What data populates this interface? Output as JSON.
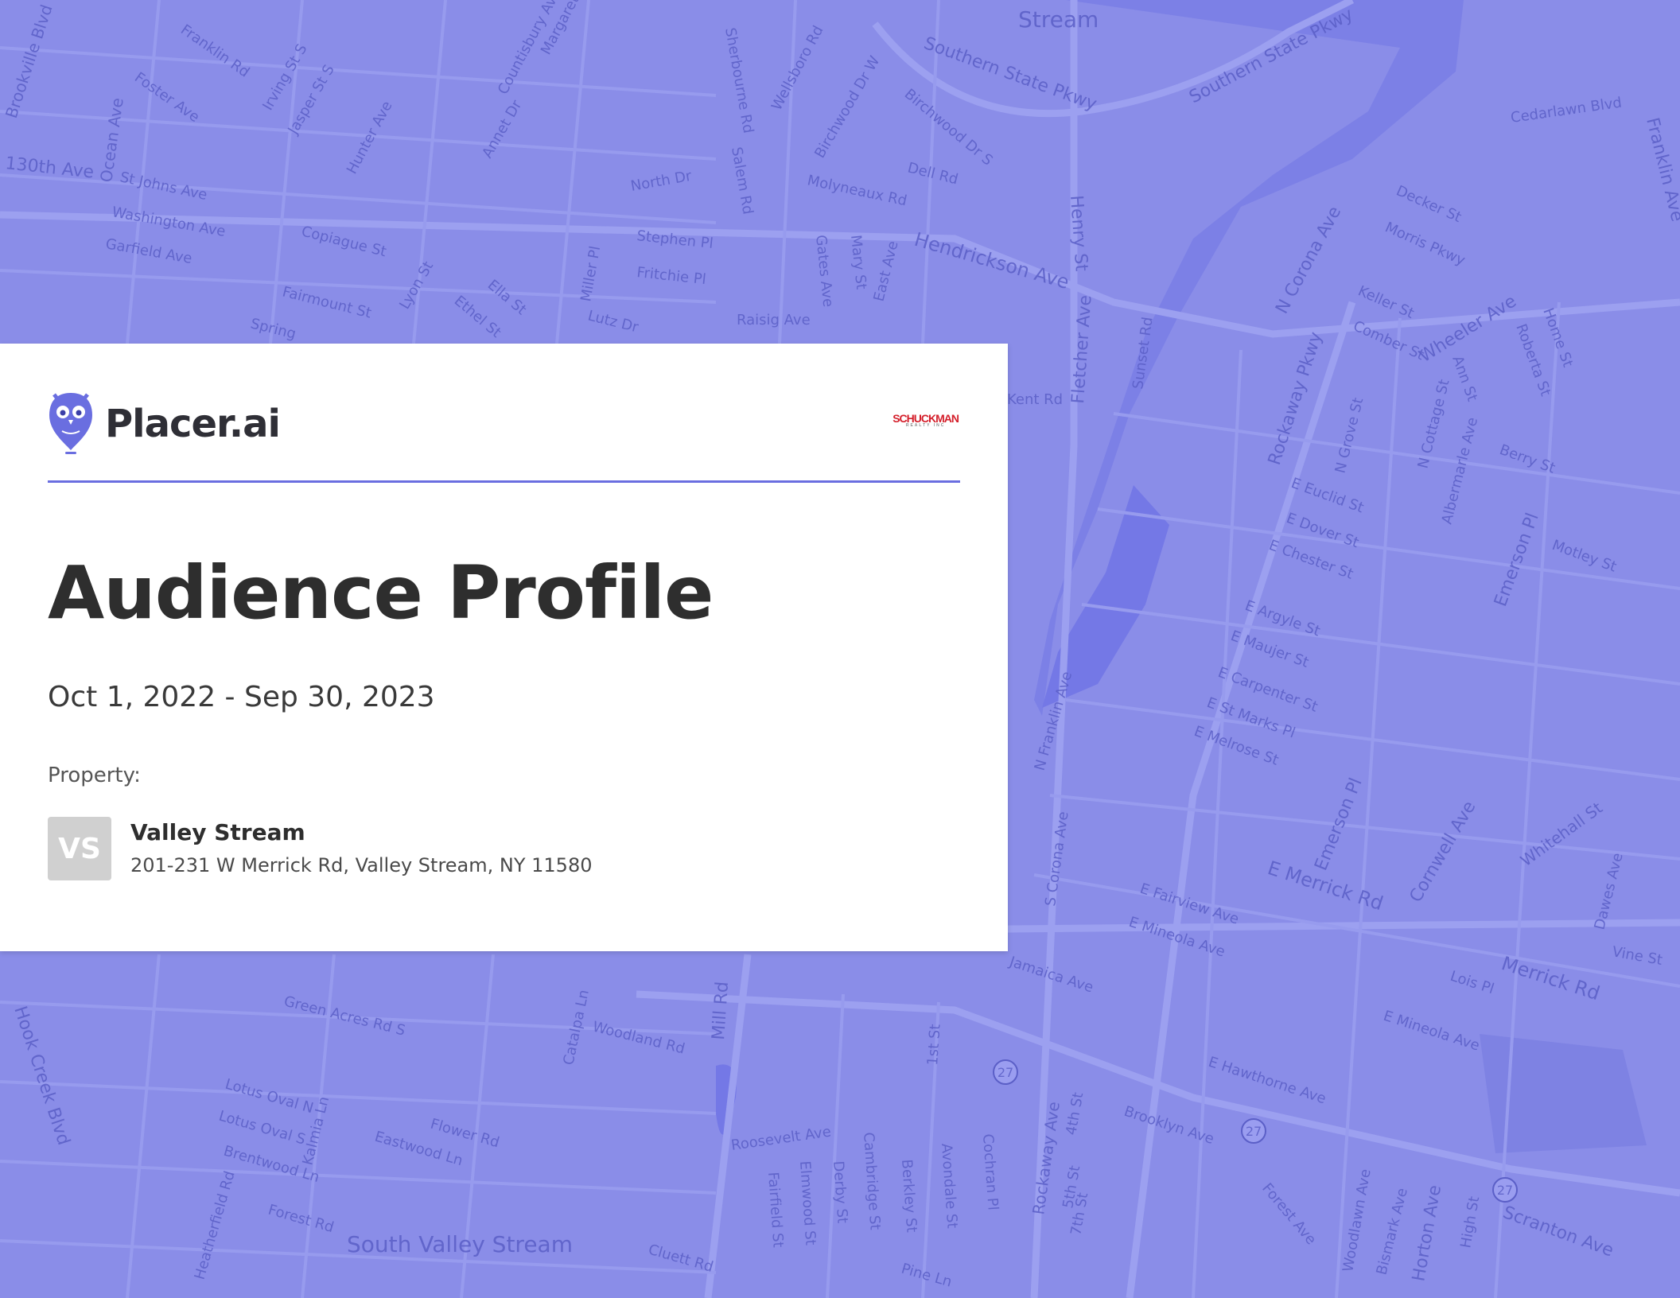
{
  "map": {
    "background_color": "#8a8de8",
    "water_color": "#7478e6",
    "road_color": "#9a9df0",
    "labels": [
      "Stream",
      "Southern State Pkwy",
      "Southern State Pkwy",
      "Brookville Blvd",
      "Ocean Ave",
      "130th Ave",
      "St Johns Ave",
      "Washington Ave",
      "Garfield Ave",
      "Copiague St",
      "Fairmount St",
      "Spring",
      "Foster Ave",
      "Franklin Rd",
      "Irving St S",
      "Jasper St S",
      "Hunter Ave",
      "Countisbury Ave",
      "Margaret Dr",
      "Annet Dr",
      "North Dr",
      "Stephen Pl",
      "Fritchie Pl",
      "Raisig Ave",
      "Lutz Dr",
      "Ella St",
      "Ethel St",
      "Lyon St",
      "Miller Pl",
      "Salem Rd",
      "Molyneaux Rd",
      "Dell Rd",
      "Birchwood Dr S",
      "Birchwood Dr W",
      "Wellsboro Rd",
      "Sherbourne Rd",
      "Gates Ave",
      "Mary St",
      "East Ave",
      "Hendrickson Ave",
      "Henry St",
      "Fletcher Ave",
      "Sunset Rd",
      "Kent Rd",
      "N Corona Ave",
      "Rockaway Pkwy",
      "Cedarlawn Blvd",
      "Decker St",
      "Morris Pkwy",
      "Keller St",
      "Comber St",
      "Wheeler Ave",
      "Franklin Ave",
      "Emerson Pl",
      "Home St",
      "Roberta St",
      "Ann St",
      "Berry St",
      "E Euclid St",
      "E Dover St",
      "E Chester St",
      "N Grove St",
      "N Cottage St",
      "Albermarle Ave",
      "Motley St",
      "E Argyle St",
      "E Maujer St",
      "E Carpenter St",
      "E St Marks Pl",
      "E Melrose St",
      "Emerson Pl",
      "Cornwell Ave",
      "Whitehall St",
      "E Merrick Rd",
      "E Fairview Ave",
      "E Mineola Ave",
      "Merrick Rd",
      "Lois Pl",
      "Vine St",
      "Dawes Ave",
      "E Mineola Ave",
      "E Hawthorne Ave",
      "Brooklyn Ave",
      "Green Acres Rd S",
      "Woodland Rd",
      "Catalpa Ln",
      "Mill Rd",
      "Hook Creek Blvd",
      "Lotus Oval N",
      "Lotus Oval S",
      "Brentwood Ln",
      "Kalmia Ln",
      "Flower Rd",
      "Eastwood Ln",
      "Forest Rd",
      "Roosevelt Ave",
      "Fairfield St",
      "Elmwood St",
      "Derby St",
      "Cambridge St",
      "Berkley St",
      "Avondale St",
      "Cochran Pl",
      "1st St",
      "Rockaway Ave",
      "4th St",
      "5th St",
      "7th St",
      "Forest Ave",
      "Woodlawn Ave",
      "Bismark Ave",
      "Horton Ave",
      "High St",
      "Scranton Ave",
      "South Valley Stream",
      "Cluett Rd",
      "Pine Ln",
      "Jamaica Ave",
      "S Corona Ave",
      "N Franklin Ave",
      "Heatherfield Rd"
    ],
    "route_shields": [
      "27",
      "27",
      "27"
    ]
  },
  "card": {
    "brand_name": "Placer.ai",
    "partner_logo_text": "SCHUCKMAN",
    "partner_logo_subtext": "REALTY INC",
    "title": "Audience Profile",
    "date_range": "Oct 1, 2022 - Sep 30, 2023",
    "property_label": "Property:",
    "property": {
      "initials": "VS",
      "name": "Valley Stream",
      "address": "201-231 W Merrick Rd, Valley Stream, NY 11580"
    }
  },
  "colors": {
    "accent": "#6a6ee0",
    "title_text": "#2e2e2e",
    "badge_bg": "#d0d0d0",
    "partner_red": "#d41e2a"
  }
}
